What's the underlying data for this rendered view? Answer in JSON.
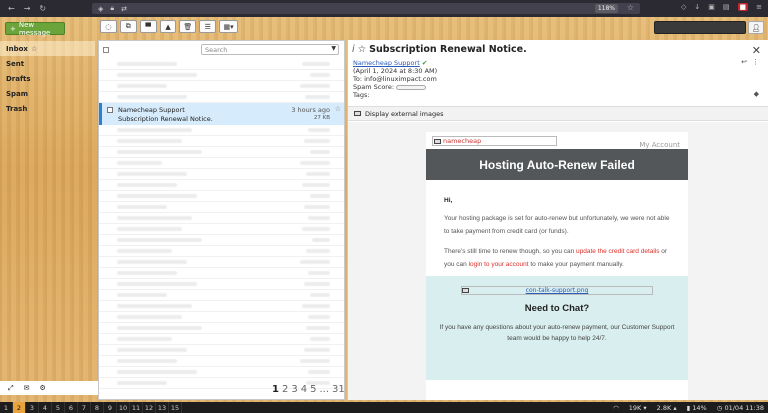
{
  "browser": {
    "zoom": "118%",
    "nav_icons": [
      "back-icon",
      "forward-icon",
      "reload-icon"
    ]
  },
  "app": {
    "compose_label": "New message"
  },
  "folders": [
    {
      "label": "Inbox",
      "active": true,
      "star": "☆"
    },
    {
      "label": "Sent",
      "active": false
    },
    {
      "label": "Drafts",
      "active": false
    },
    {
      "label": "Spam",
      "active": false
    },
    {
      "label": "Trash",
      "active": false
    }
  ],
  "list": {
    "search_placeholder": "Search",
    "selected": {
      "from": "Namecheap Support",
      "subject": "Subscription Renewal Notice.",
      "time": "3 hours ago",
      "size": "27 KB"
    },
    "pager": {
      "current": "1",
      "pages": [
        "2",
        "3",
        "4",
        "5",
        "...",
        "31"
      ]
    }
  },
  "message": {
    "subject": "Subscription Renewal Notice.",
    "sender": "Namecheap Support",
    "date": "(April 1, 2024 at 8:30 AM)",
    "to": "To: info@linuximpact.com",
    "spam_label": "Spam Score:",
    "tags_label": "Tags:",
    "external_images": "Display external images",
    "body": {
      "logo_alt": "namecheap",
      "my_account": "My Account",
      "banner": "Hosting Auto-Renew Failed",
      "greeting": "Hi,",
      "p1": "Your hosting package is set for auto-renew but unfortunately, we were not able to take payment from credit card (or funds).",
      "p2_a": "There's still time to renew though, so you can ",
      "p2_link1": "update the credit card details",
      "p2_b": " or you can ",
      "p2_link2": "login to your account",
      "p2_c": " to make your payment manually.",
      "chat_img": "con-talk-support.png",
      "chat_title": "Need to Chat?",
      "chat_text": "If you have any questions about your auto-renew payment, our Customer Support team would be happy to help 24/7."
    }
  },
  "taskbar": {
    "workspaces": [
      "1",
      "2",
      "3",
      "4",
      "5",
      "6",
      "7",
      "8",
      "9",
      "10",
      "11",
      "12",
      "13",
      "15"
    ],
    "active_workspace": "2",
    "net_down": "19K",
    "net_up": "2.8K",
    "battery": "14%",
    "clock": "01/04 11:38"
  }
}
